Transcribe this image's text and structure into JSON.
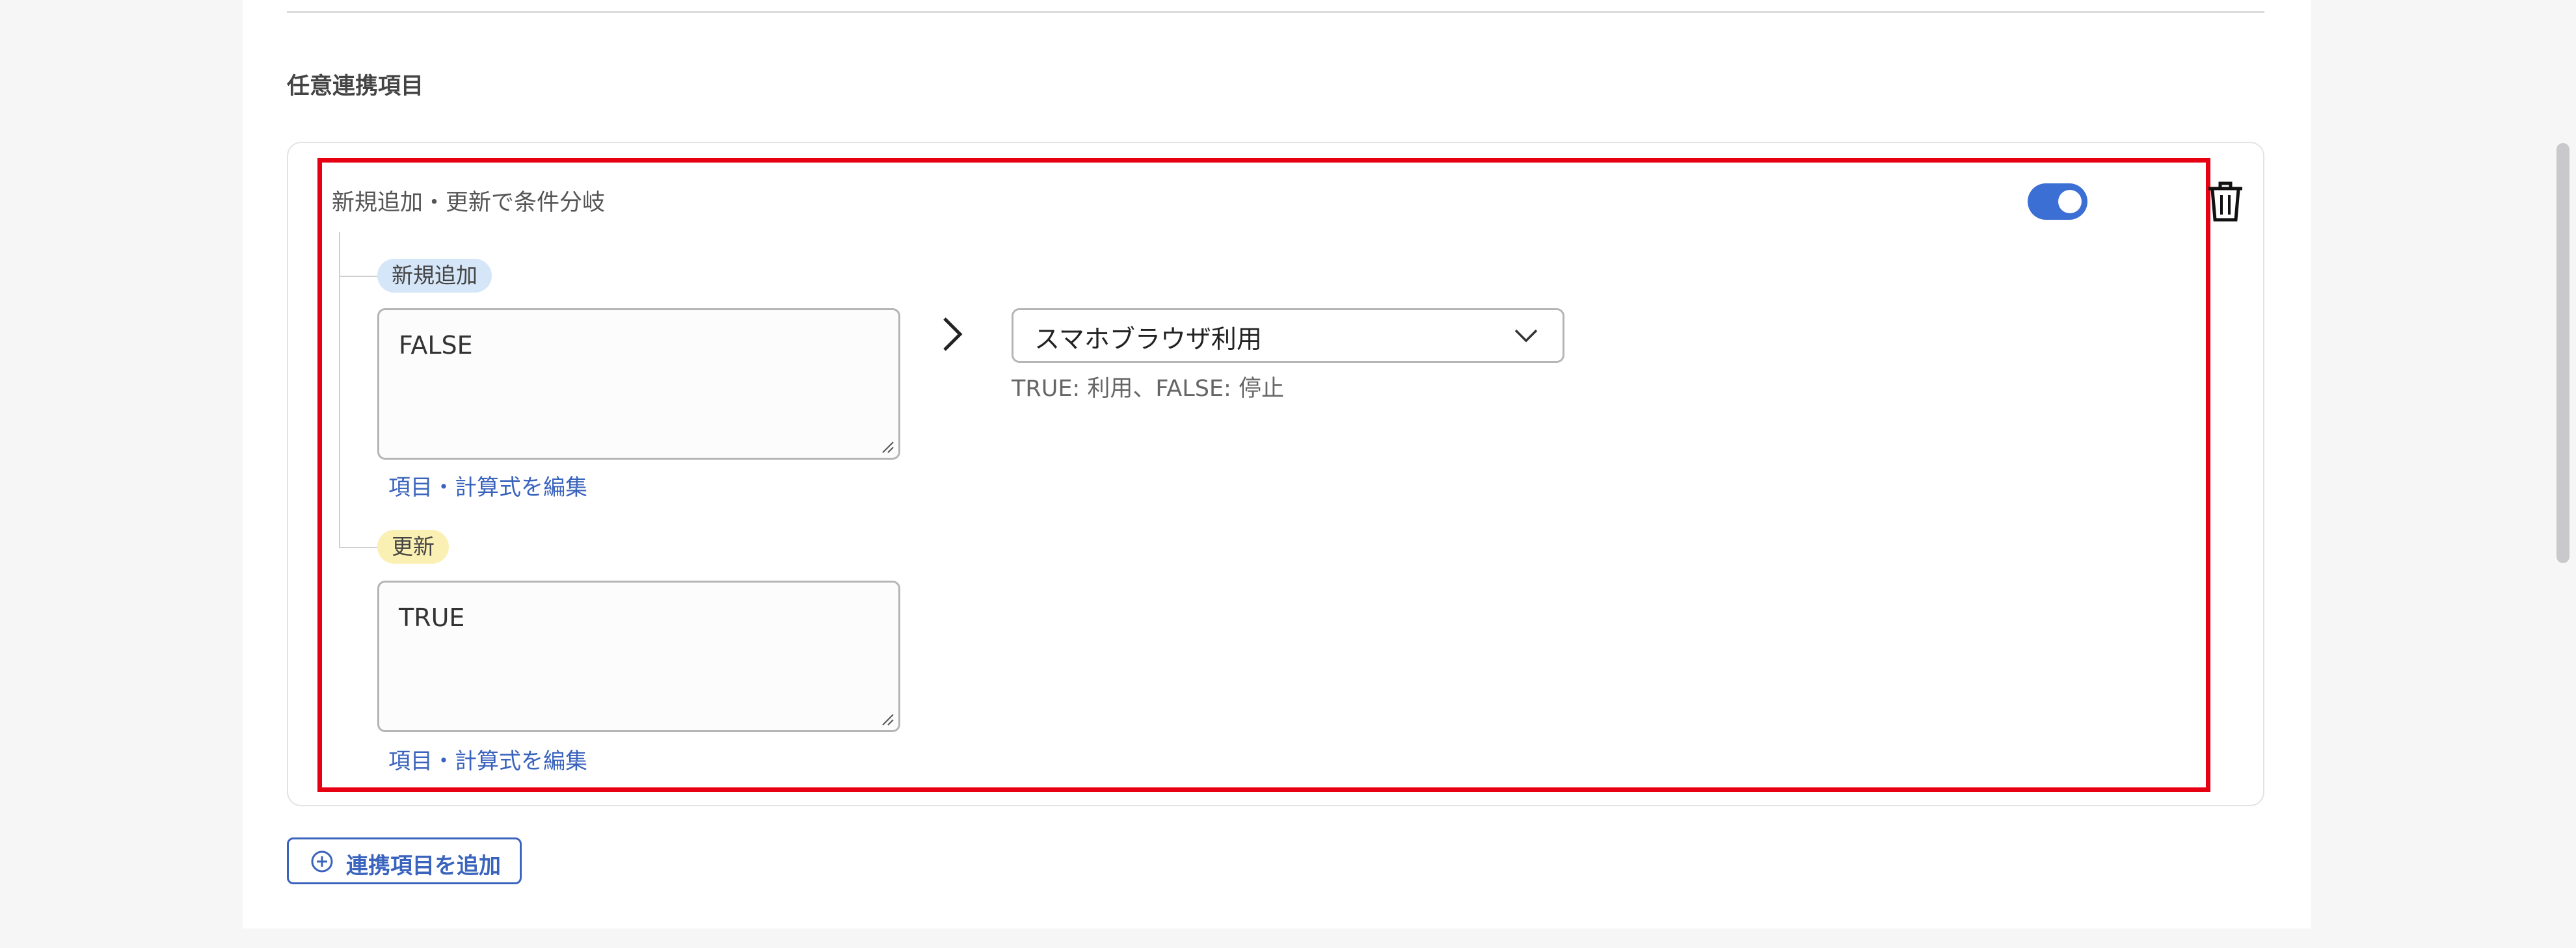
{
  "section": {
    "title": "任意連携項目"
  },
  "rule": {
    "label": "新規追加・更新で条件分岐",
    "enabled": true,
    "branches": [
      {
        "tag": "新規追加",
        "tag_color": "#d5e6f8",
        "formula": "FALSE",
        "edit_link": "項目・計算式を編集"
      },
      {
        "tag": "更新",
        "tag_color": "#fbf0b3",
        "formula": "TRUE",
        "edit_link": "項目・計算式を編集"
      }
    ],
    "target": {
      "selected": "スマホブラウザ利用",
      "hint": "TRUE: 利用、FALSE: 停止"
    }
  },
  "add_button": {
    "label": "連携項目を追加"
  },
  "colors": {
    "accent": "#3b6fd4",
    "link": "#3a63bd",
    "highlight": "#e60012"
  },
  "icons": [
    "arrow-right-icon",
    "chevron-down-icon",
    "trash-icon",
    "plus-circle-icon",
    "toggle-switch"
  ]
}
